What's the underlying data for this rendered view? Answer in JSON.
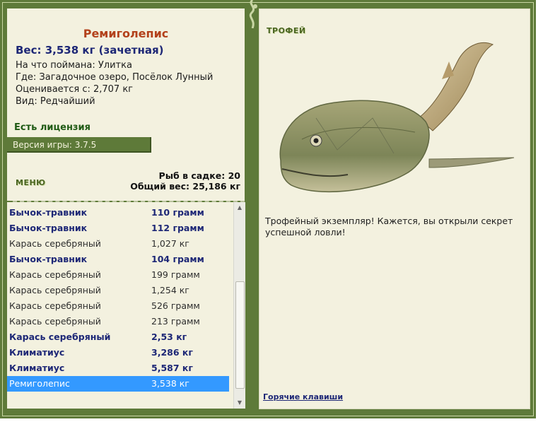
{
  "catch": {
    "title": "Ремиголепис",
    "weight": "Вес: 3,538 кг (зачетная)",
    "bait": "На что поймана: Улитка",
    "location": "Где: Загадочное озеро, Посёлок Лунный",
    "value": "Оценивается с: 2,707 кг",
    "kind": "Вид: Редчайший"
  },
  "license": "Есть лицензия",
  "version": "Версия игры: 3.7.5",
  "menu_label": "МЕНЮ",
  "keepnet": {
    "count": "Рыб в садке: 20",
    "total": "Общий вес: 25,186 кг"
  },
  "fish_list": [
    {
      "name": "Бычок-травник",
      "weight": "110 грамм",
      "style": "bold"
    },
    {
      "name": "Бычок-травник",
      "weight": "112 грамм",
      "style": "bold"
    },
    {
      "name": "Карась серебряный",
      "weight": "1,027 кг",
      "style": "plain"
    },
    {
      "name": "Бычок-травник",
      "weight": "104 грамм",
      "style": "bold"
    },
    {
      "name": "Карась серебряный",
      "weight": "199 грамм",
      "style": "plain"
    },
    {
      "name": "Карась серебряный",
      "weight": "1,254 кг",
      "style": "plain"
    },
    {
      "name": "Карась серебряный",
      "weight": "526 грамм",
      "style": "plain"
    },
    {
      "name": "Карась серебряный",
      "weight": "213 грамм",
      "style": "plain"
    },
    {
      "name": "Карась серебряный",
      "weight": "2,53 кг",
      "style": "bold"
    },
    {
      "name": "Климатиус",
      "weight": "3,286 кг",
      "style": "bold"
    },
    {
      "name": "Климатиус",
      "weight": "5,587 кг",
      "style": "bold"
    },
    {
      "name": "Ремиголепис",
      "weight": "3,538 кг",
      "style": "selected"
    }
  ],
  "trophy_label": "ТРОФЕЙ",
  "trophy_text": "Трофейный экземпляр! Кажется, вы открыли секрет успешной ловли!",
  "hotkeys_label": "Горячие клавиши",
  "colors": {
    "frame": "#5e7a39",
    "panel": "#f3f1df",
    "title": "#b3411b",
    "accent_blue": "#1d2776",
    "selected": "#3399ff"
  }
}
